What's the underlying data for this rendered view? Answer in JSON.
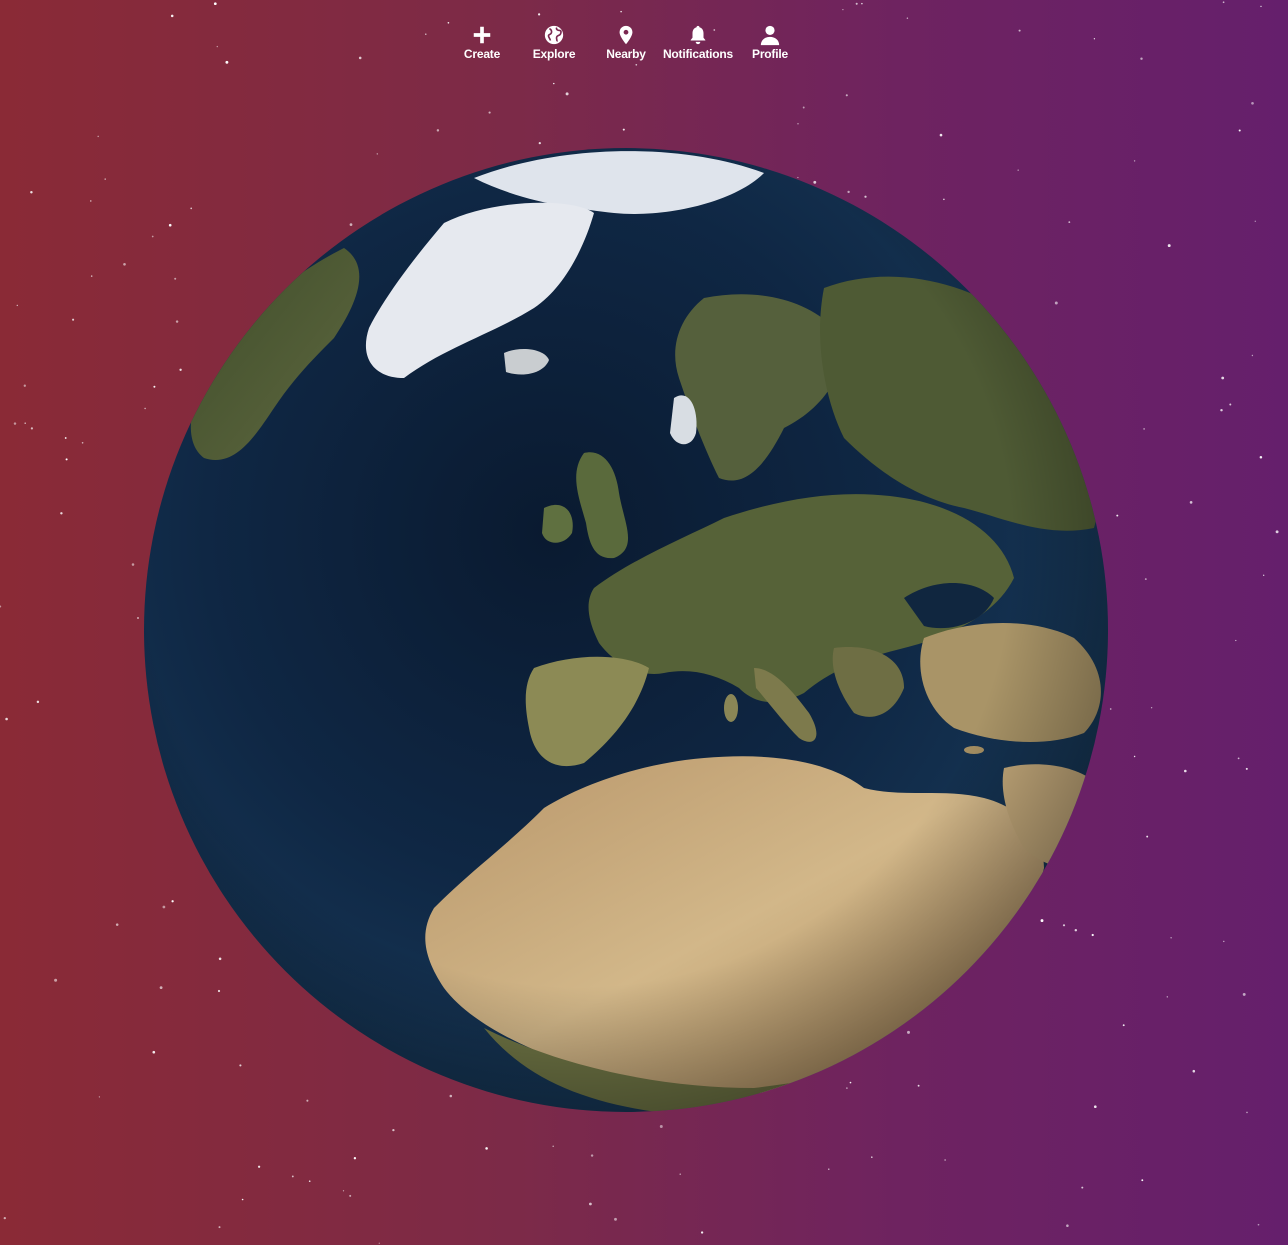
{
  "nav": {
    "items": [
      {
        "label": "Create",
        "icon": "plus-icon"
      },
      {
        "label": "Explore",
        "icon": "globe-icon"
      },
      {
        "label": "Nearby",
        "icon": "map-pin-icon"
      },
      {
        "label": "Notifications",
        "icon": "bell-icon"
      },
      {
        "label": "Profile",
        "icon": "user-icon"
      }
    ]
  },
  "theme": {
    "background_left": "#8a2a36",
    "background_right": "#651f6c",
    "ocean": "#0d2340",
    "land_green": "#4d5a34",
    "land_desert": "#c4a676",
    "ice": "#e8ecf2"
  }
}
